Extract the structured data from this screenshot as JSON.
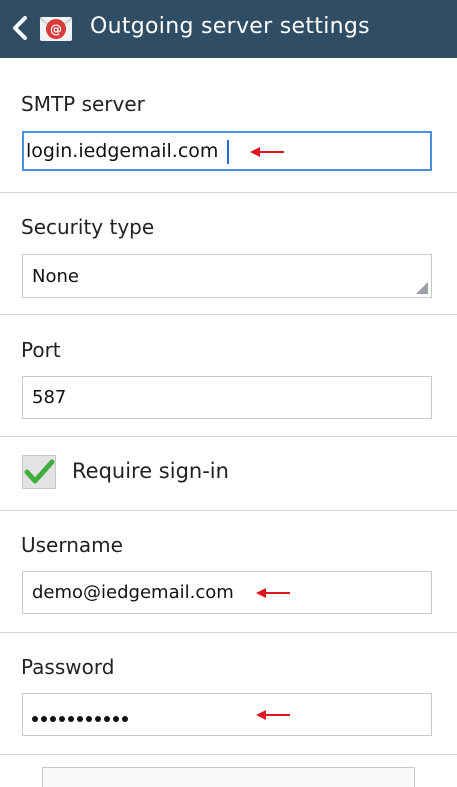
{
  "header": {
    "title": "Outgoing server settings",
    "back_icon": "back-chevron-icon",
    "app_icon": "email-app-icon"
  },
  "smtp": {
    "label": "SMTP server",
    "value": "login.iedgemail.com"
  },
  "security": {
    "label": "Security type",
    "value": "None"
  },
  "port": {
    "label": "Port",
    "value": "587"
  },
  "require_signin": {
    "label": "Require sign-in",
    "checked": true
  },
  "username": {
    "label": "Username",
    "value": "demo@iedgemail.com"
  },
  "password": {
    "label": "Password",
    "masked_length": 11
  },
  "colors": {
    "header_bg": "#2f4e66",
    "accent": "#4a90e2",
    "checkmark": "#3fae3f",
    "annotation_arrow": "#e0141c"
  }
}
